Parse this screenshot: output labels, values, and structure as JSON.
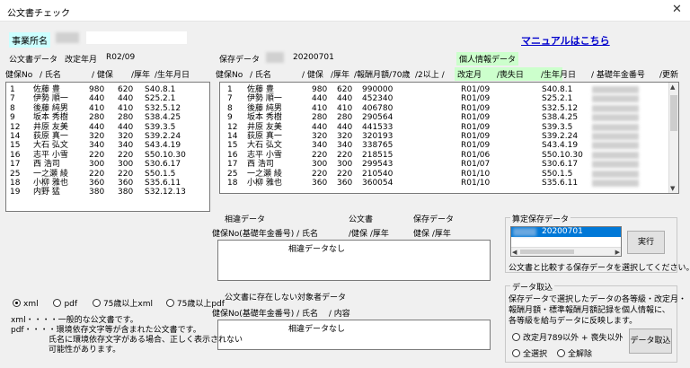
{
  "window": {
    "title": "公文書チェック",
    "close_glyph": "✕"
  },
  "office": {
    "label": "事業所名"
  },
  "manual_link": "マニュアルはこちら",
  "left": {
    "section_label": "公文書データ",
    "revision_label": "改定年月",
    "revision_value": "R02/09",
    "headers": [
      "健保No",
      "/ 氏名",
      "/ 健保",
      "/厚年",
      "/生年月日"
    ],
    "rows": [
      [
        "1",
        "佐藤 豊",
        "980",
        "620",
        "S40.8.1"
      ],
      [
        "7",
        "伊勢 順一",
        "440",
        "440",
        "S25.2.1"
      ],
      [
        "8",
        "後藤 純男",
        "410",
        "410",
        "S32.5.12"
      ],
      [
        "9",
        "坂本 秀樹",
        "280",
        "280",
        "S38.4.25"
      ],
      [
        "12",
        "井原 友美",
        "440",
        "440",
        "S39.3.5"
      ],
      [
        "14",
        "荻原 真一",
        "320",
        "320",
        "S39.2.24"
      ],
      [
        "15",
        "大石 弘文",
        "340",
        "340",
        "S43.4.19"
      ],
      [
        "16",
        "志平 小雪",
        "220",
        "220",
        "S50.10.30"
      ],
      [
        "17",
        "西 浩司",
        "300",
        "300",
        "S30.6.17"
      ],
      [
        "25",
        "一之瀬 綾",
        "220",
        "220",
        "S50.1.5"
      ],
      [
        "18",
        "小柳 雅也",
        "360",
        "360",
        "S35.6.11"
      ],
      [
        "19",
        "内野 猛",
        "380",
        "380",
        "S32.12.13"
      ]
    ]
  },
  "right": {
    "section_label": "保存データ",
    "save_value": "20200701",
    "personal_label": "個人情報データ",
    "headers_a": [
      "健保No",
      "/ 氏名",
      "/ 健保",
      "/厚年",
      "/報酬月額/70歳",
      "/2以上 /"
    ],
    "headers_b": [
      "改定月",
      "/喪失日",
      "/生年月日",
      "/ 基礎年金番号",
      "/更新"
    ],
    "rows": [
      [
        "1",
        "佐藤 豊",
        "980",
        "620",
        "990000",
        "R01/09",
        "S40.8.1"
      ],
      [
        "7",
        "伊勢 順一",
        "440",
        "440",
        "452340",
        "R01/09",
        "S25.2.1"
      ],
      [
        "8",
        "後藤 純男",
        "410",
        "410",
        "406780",
        "R01/09",
        "S32.5.12"
      ],
      [
        "9",
        "坂本 秀樹",
        "280",
        "280",
        "290564",
        "R01/09",
        "S38.4.25"
      ],
      [
        "12",
        "井原 友美",
        "440",
        "440",
        "441533",
        "R01/09",
        "S39.3.5"
      ],
      [
        "14",
        "荻原 真一",
        "320",
        "320",
        "320193",
        "R01/09",
        "S39.2.24"
      ],
      [
        "15",
        "大石 弘文",
        "340",
        "340",
        "338765",
        "R01/09",
        "S43.4.19"
      ],
      [
        "16",
        "志平 小雪",
        "220",
        "220",
        "218515",
        "R01/06",
        "S50.10.30"
      ],
      [
        "17",
        "西 浩司",
        "300",
        "300",
        "299543",
        "R01/07",
        "S30.6.17"
      ],
      [
        "25",
        "一之瀬 綾",
        "220",
        "220",
        "210540",
        "R01/10",
        "S50.1.5"
      ],
      [
        "18",
        "小柳 雅也",
        "360",
        "360",
        "360054",
        "R01/10",
        "S35.6.11"
      ]
    ]
  },
  "match": {
    "label": "相違データ",
    "col_doc": "公文書",
    "col_save": "保存データ",
    "headers": "健保No(基礎年金番号) / 氏名",
    "headers_doc": "/健保 /厚年",
    "headers_save": "健保 /厚年",
    "empty": "相違データなし"
  },
  "missing": {
    "label": "公文書に存在しない対象者データ",
    "headers": "健保No(基礎年金番号) / 氏名　 / 内容",
    "empty": "相違データなし"
  },
  "format": {
    "options": [
      "xml",
      "pdf",
      "75歳以上xml",
      "75歳以上pdf"
    ],
    "selected": "xml",
    "note1": "xml・・・・一般的な公文書です。",
    "note2": "pdf・・・・環境依存文字等が含まれた公文書です。",
    "note3": "氏名に環境依存文字がある場合、正しく表示されない",
    "note4": "可能性があります。"
  },
  "calc": {
    "group_label": "算定保存データ",
    "selected_value": "20200701",
    "run_button": "実行",
    "hint": "公文書と比較する保存データを選択してください。"
  },
  "import": {
    "group_label": "データ取込",
    "desc1": "保存データで選択したデータの各等級・改定月・",
    "desc2": "報酬月額・標準報酬月額記録を個人情報に、",
    "desc3": "各等級を給与データに反映します。",
    "opt1": "改定月789以外 + 喪失以外",
    "opt2": "全選択",
    "opt3": "全解除",
    "button": "データ取込"
  }
}
